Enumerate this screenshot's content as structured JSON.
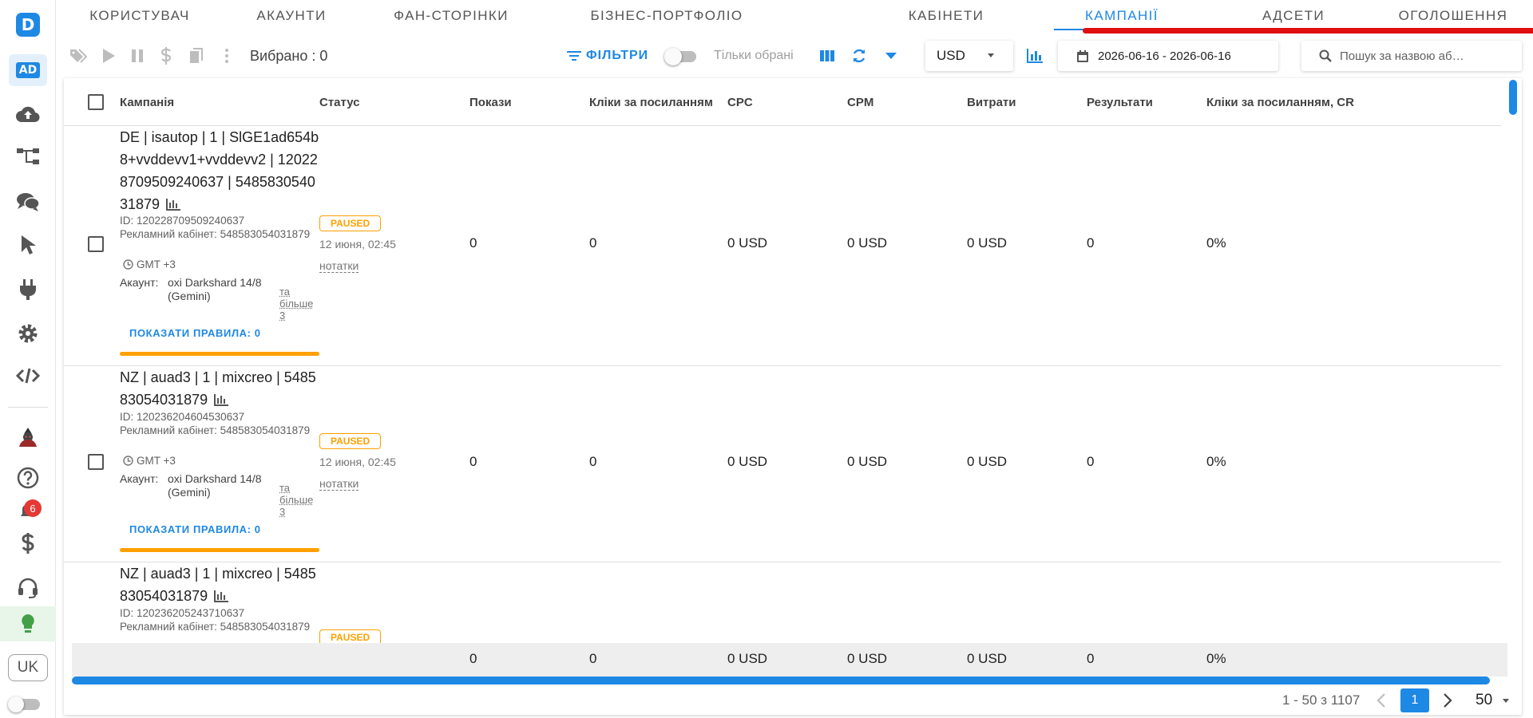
{
  "sidebar": {
    "logo_letter": "D",
    "ad_label": "AD",
    "notification_count": "6",
    "language": "UK"
  },
  "tabs": [
    {
      "label": "КОРИСТУВАЧ"
    },
    {
      "label": "АКАУНТИ"
    },
    {
      "label": "ФАН-СТОРІНКИ"
    },
    {
      "label": "БІЗНЕС-ПОРТФОЛІО"
    },
    {
      "label": "КАБІНЕТИ"
    },
    {
      "label": "КАМПАНІЇ",
      "active": true
    },
    {
      "label": "АДСЕТИ"
    },
    {
      "label": "ОГОЛОШЕННЯ"
    }
  ],
  "toolbar": {
    "selected_label": "Вибрано : 0",
    "filters_label": "ФІЛЬТРИ",
    "only_selected_label": "Тільки обрані",
    "currency": "USD",
    "date_range": "2026-06-16 - 2026-06-16",
    "search_placeholder": "Пошук за назвою аб…"
  },
  "colors": {
    "accent": "#1e88e5",
    "paused": "#ffa000",
    "highlight_line": "#e01010"
  },
  "table": {
    "columns": [
      "Кампанія",
      "Статус",
      "Покази",
      "Кліки за посиланням",
      "CPC",
      "CPM",
      "Витрати",
      "Результати",
      "Кліки за посиланням, CR"
    ],
    "rows": [
      {
        "name": "DE | isautop | 1 | SlGE1ad654b8+vvddevv1+vvddevv2 | 120228709509240637 | 548583054031879",
        "id": "ID: 120228709509240637",
        "cabinet": "Рекламний кабінет: 548583054031879",
        "gmt": "GMT +3",
        "account_label": "Акаунт:",
        "account": "oxi Darkshard 14/8 (Gemini)",
        "more": "та більше 3",
        "rules": "ПОКАЗАТИ ПРАВИЛА: 0",
        "status": "PAUSED",
        "time": "12 июня, 02:45",
        "notes": "нотатки",
        "impressions": "0",
        "link_clicks": "0",
        "cpc": "0 USD",
        "cpm": "0 USD",
        "spend": "0 USD",
        "results": "0",
        "ctr": "0%"
      },
      {
        "name": "NZ | auad3 | 1 | mixcreo | 548583054031879",
        "id": "ID: 120236204604530637",
        "cabinet": "Рекламний кабінет: 548583054031879",
        "gmt": "GMT +3",
        "account_label": "Акаунт:",
        "account": "oxi Darkshard 14/8 (Gemini)",
        "more": "та більше 3",
        "rules": "ПОКАЗАТИ ПРАВИЛА: 0",
        "status": "PAUSED",
        "time": "12 июня, 02:45",
        "notes": "нотатки",
        "impressions": "0",
        "link_clicks": "0",
        "cpc": "0 USD",
        "cpm": "0 USD",
        "spend": "0 USD",
        "results": "0",
        "ctr": "0%"
      },
      {
        "name": "NZ | auad3 | 1 | mixcreo | 548583054031879",
        "id": "ID: 120236205243710637",
        "cabinet": "Рекламний кабінет: 548583054031879",
        "status": "PAUSED"
      }
    ],
    "summary": {
      "impressions": "0",
      "link_clicks": "0",
      "cpc": "0 USD",
      "cpm": "0 USD",
      "spend": "0 USD",
      "results": "0",
      "ctr": "0%"
    }
  },
  "pagination": {
    "range": "1 - 50 з 1107",
    "current_page": "1",
    "page_size": "50"
  }
}
